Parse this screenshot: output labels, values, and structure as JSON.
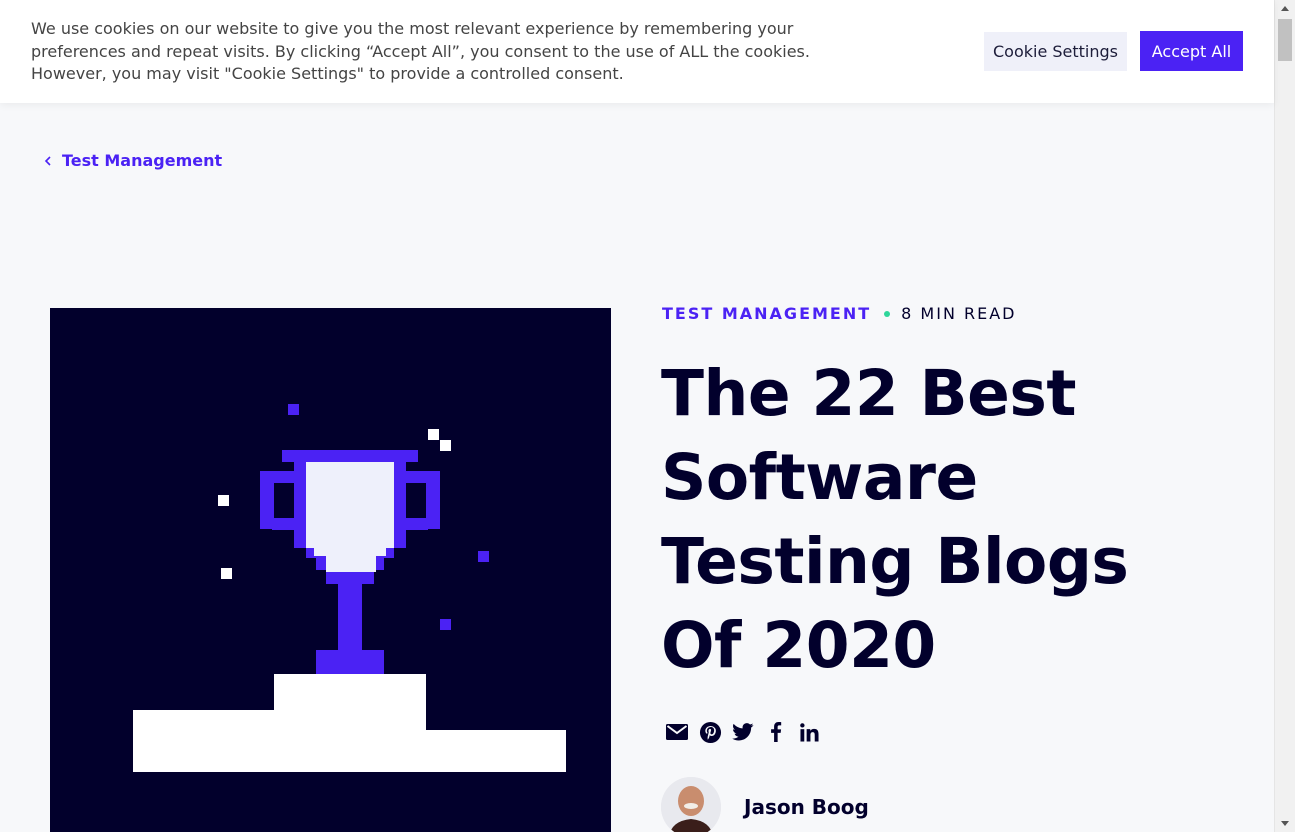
{
  "cookie_banner": {
    "text": "We use cookies on our website to give you the most relevant experience by remembering your preferences and repeat visits. By clicking “Accept All”, you consent to the use of ALL the cookies. However, you may visit \"Cookie Settings\" to provide a controlled consent.",
    "settings_label": "Cookie Settings",
    "accept_label": "Accept All"
  },
  "breadcrumb": {
    "label": "Test Management",
    "icon": "chevron-left-icon"
  },
  "article": {
    "category": "TEST MANAGEMENT",
    "read_time": "8 MIN READ",
    "title": "The 22 Best Software Testing Blogs Of 2020",
    "author": "Jason Boog",
    "share_icons": [
      "email-icon",
      "pinterest-icon",
      "twitter-icon",
      "facebook-icon",
      "linkedin-icon"
    ]
  },
  "hero_image": {
    "subject": "trophy-icon"
  },
  "colors": {
    "accent": "#4b22f4",
    "dark": "#02002c",
    "dot": "#2fd69a",
    "background": "#f7f8fa"
  }
}
